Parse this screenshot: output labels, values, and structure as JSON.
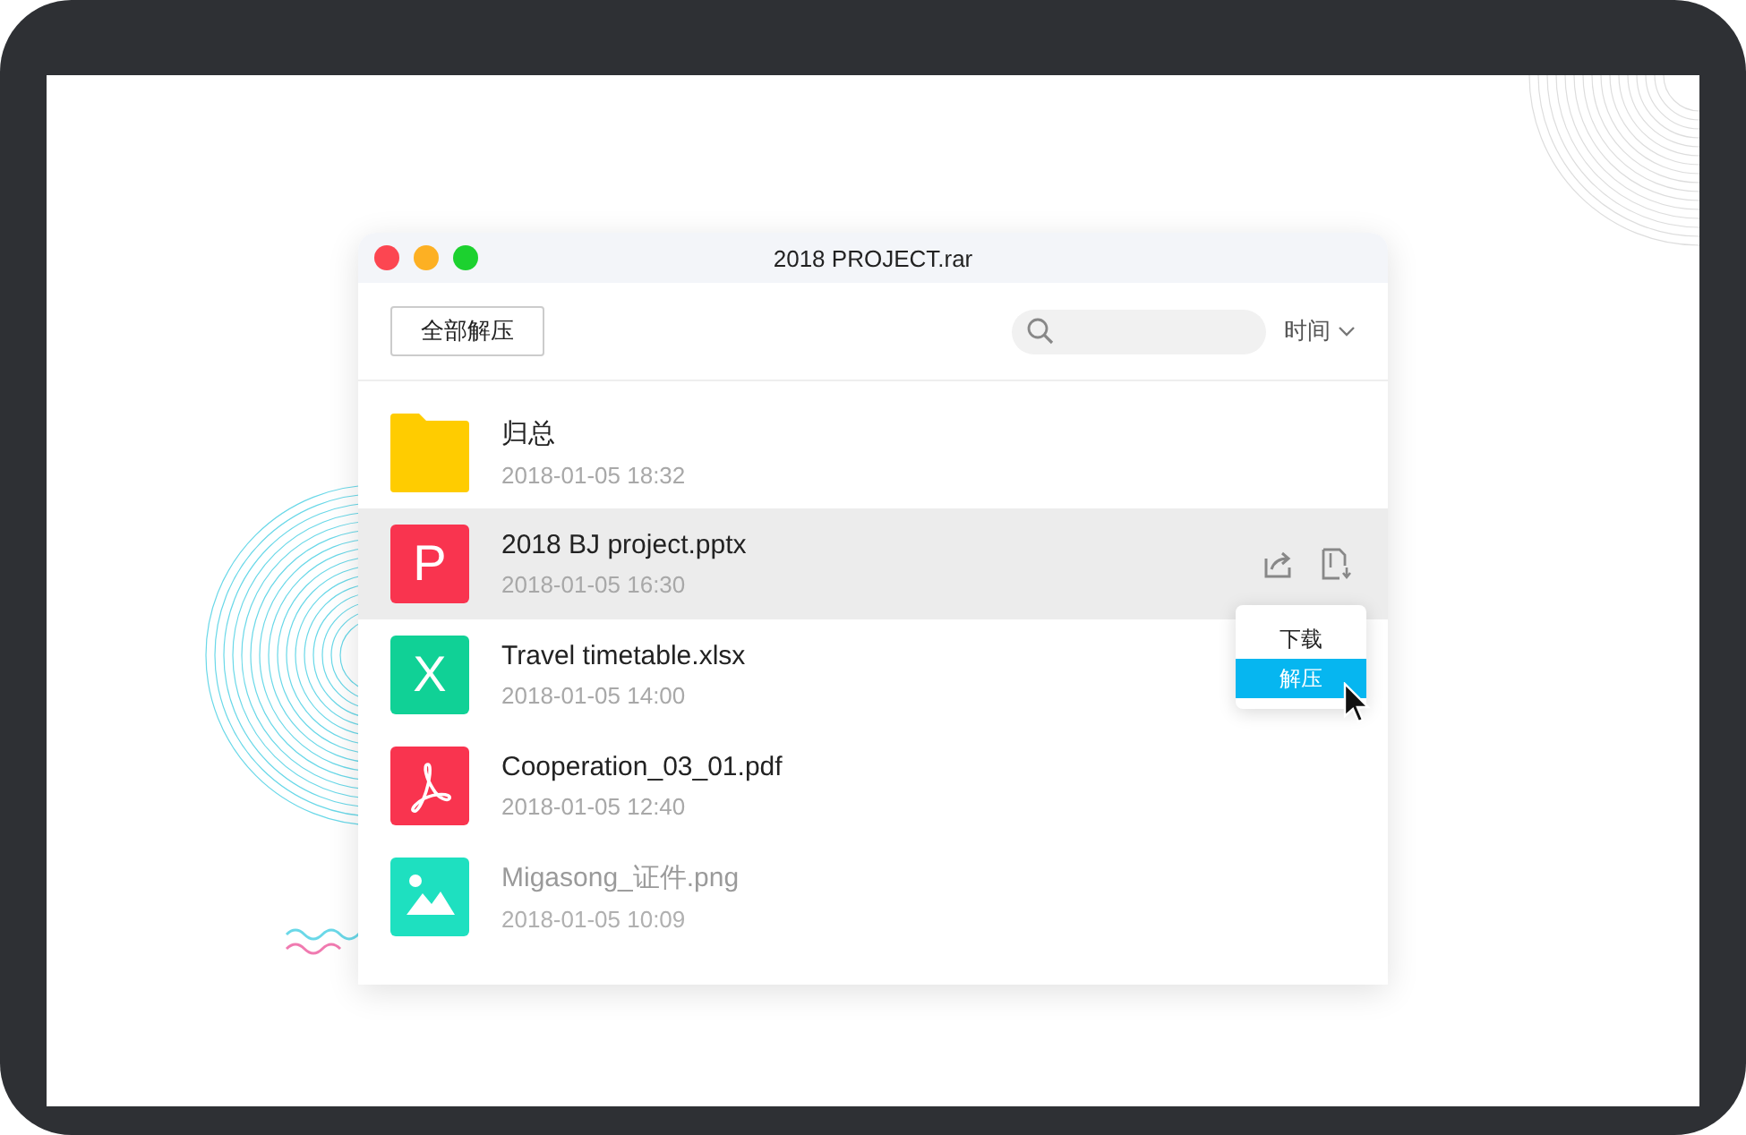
{
  "window": {
    "title": "2018 PROJECT.rar"
  },
  "toolbar": {
    "extract_all": "全部解压",
    "sort": "时间"
  },
  "files": [
    {
      "kind": "folder",
      "name": "归总",
      "time": "2018-01-05 18:32",
      "selected": false,
      "faded": false,
      "color": "#ffcc00"
    },
    {
      "kind": "letter",
      "letter": "P",
      "name": "2018 BJ project.pptx",
      "time": "2018-01-05 16:30",
      "selected": true,
      "faded": false,
      "color": "#f9344f"
    },
    {
      "kind": "letter",
      "letter": "X",
      "name": "Travel timetable.xlsx",
      "time": "2018-01-05 14:00",
      "selected": false,
      "faded": false,
      "color": "#10d196"
    },
    {
      "kind": "pdf",
      "name": "Cooperation_03_01.pdf",
      "time": "2018-01-05 12:40",
      "selected": false,
      "faded": false,
      "color": "#f9344f"
    },
    {
      "kind": "image",
      "name": "Migasong_证件.png",
      "time": "2018-01-05 10:09",
      "selected": false,
      "faded": true,
      "color": "#1ee0c0"
    }
  ],
  "menu": [
    {
      "label": "下载",
      "selected": false
    },
    {
      "label": "解压",
      "selected": true
    }
  ]
}
